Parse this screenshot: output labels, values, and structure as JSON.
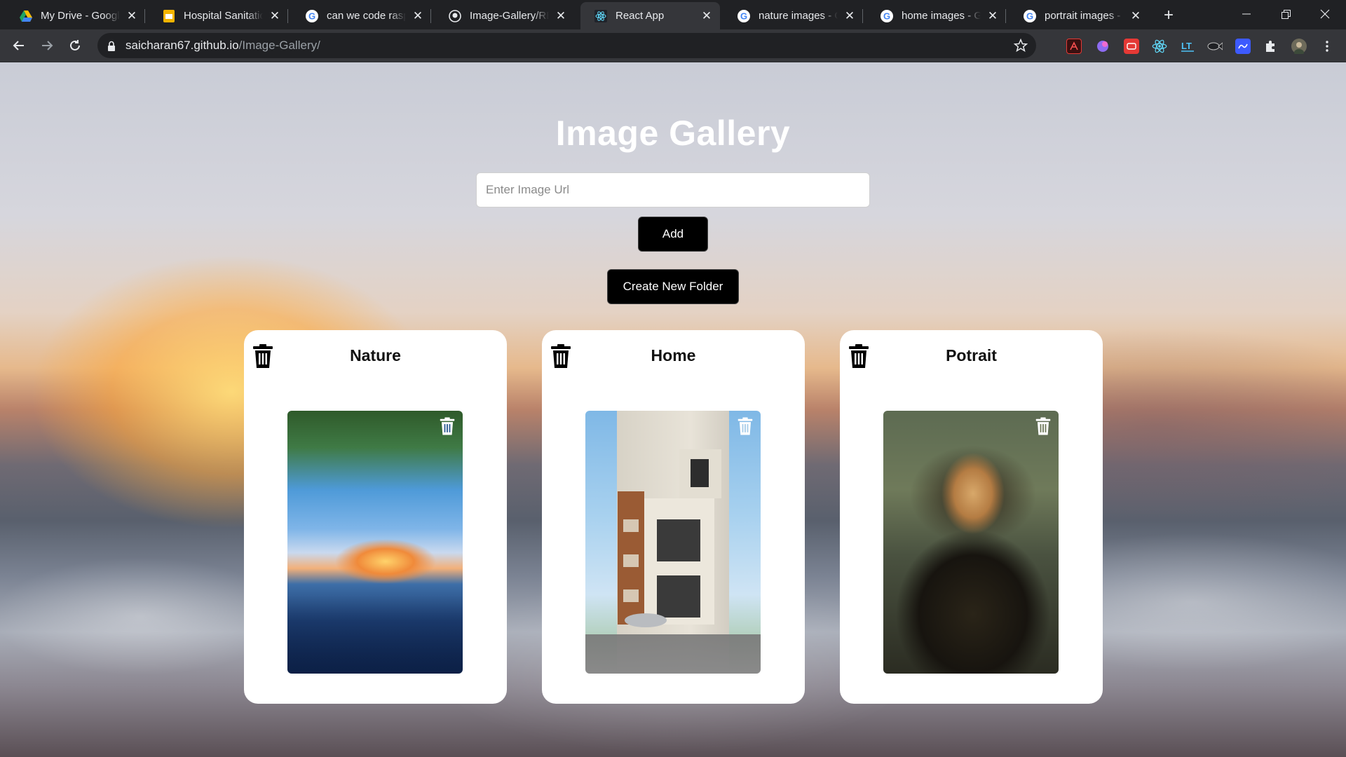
{
  "browser": {
    "tabs": [
      {
        "title": "My Drive - Google Drive",
        "icon": "google-drive-icon",
        "active": false
      },
      {
        "title": "Hospital Sanitation",
        "icon": "google-slides-icon",
        "active": false
      },
      {
        "title": "can we code raspberry",
        "icon": "google-icon",
        "active": false
      },
      {
        "title": "Image-Gallery/README",
        "icon": "github-icon",
        "active": false
      },
      {
        "title": "React App",
        "icon": "react-icon",
        "active": true
      },
      {
        "title": "nature images - Google",
        "icon": "google-icon",
        "active": false
      },
      {
        "title": "home images - Google",
        "icon": "google-icon",
        "active": false
      },
      {
        "title": "portrait images - Google",
        "icon": "google-icon",
        "active": false
      }
    ],
    "address": {
      "host": "saicharan67.github.io",
      "path": "/Image-Gallery/"
    }
  },
  "app": {
    "title": "Image Gallery",
    "url_input": {
      "value": "",
      "placeholder": "Enter Image Url"
    },
    "add_label": "Add",
    "create_folder_label": "Create New Folder",
    "folders": [
      {
        "name": "Nature",
        "image": "sunset-over-lake-image"
      },
      {
        "name": "Home",
        "image": "modern-house-image"
      },
      {
        "name": "Potrait",
        "image": "mona-lisa-image"
      }
    ]
  },
  "colors": {
    "browser_frame": "#202124",
    "toolbar": "#35363a",
    "button_bg": "#000000",
    "card_bg": "#ffffff"
  }
}
